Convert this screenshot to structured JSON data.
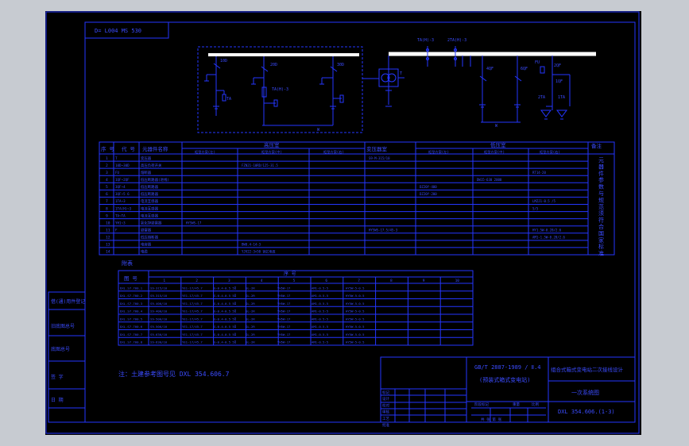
{
  "colors": {
    "line": "#2436ff",
    "text": "#3b4cff",
    "bus": "#ffffff",
    "background": "#000000",
    "window": "#c7cbd1"
  },
  "drawing_ref_tab": "D= L004 MS 530",
  "schematic": {
    "hv_labels": [
      "10D",
      "20D",
      "30D",
      "TA(H)-3",
      "TA"
    ],
    "hv_bottom": "W",
    "transformer_label": "T",
    "lv_top_labels": [
      "TA(H)-3",
      "2TA(H)-3"
    ],
    "lv_labels": [
      "4QF",
      "6QF",
      "FU",
      "2QF",
      "1QF",
      "2TA",
      "1TA"
    ],
    "lv_bottom": "W"
  },
  "main_table": {
    "headers": [
      "序 号",
      "代 号",
      "元器件名称",
      "高压室",
      "变压器室",
      "低压室",
      "备注"
    ],
    "hv_sub": [
      "柜型方案(左)",
      "柜型方案(中)",
      "柜型方案(右)"
    ],
    "lv_sub": [
      "柜型方案(左)",
      "柜型方案(中)",
      "柜型方案(右)"
    ],
    "rows": [
      {
        "no": "1",
        "code": "T",
        "name": "变压器",
        "cells": [
          "",
          "",
          "",
          "S9-M-315/10",
          "",
          "",
          ""
        ]
      },
      {
        "no": "2",
        "code": "10D~30D",
        "name": "高压负荷开关",
        "cells": [
          "",
          "FZN21-10RD/125-31.5",
          "",
          "",
          "",
          "",
          ""
        ]
      },
      {
        "no": "3",
        "code": "FU",
        "name": "熔断器",
        "cells": [
          "",
          "",
          "",
          "",
          "",
          "",
          "RT14-20"
        ]
      },
      {
        "no": "4",
        "code": "1QF~2QF",
        "name": "低压断路器(进线)",
        "cells": [
          "",
          "",
          "",
          "",
          "",
          "DW15-630 2000",
          ""
        ]
      },
      {
        "no": "5",
        "code": "3QF~4",
        "name": "低压断路器",
        "cells": [
          "",
          "",
          "",
          "",
          "DZ20Y-400",
          "",
          ""
        ]
      },
      {
        "no": "6",
        "code": "3QF~5 6",
        "name": "低压断路器",
        "cells": [
          "",
          "",
          "",
          "",
          "DZ20Y-200",
          "",
          ""
        ]
      },
      {
        "no": "7",
        "code": "1TA~3",
        "name": "电流互感器",
        "cells": [
          "",
          "",
          "",
          "",
          "",
          "",
          "LMZJ1-0.5 /5"
        ]
      },
      {
        "no": "8",
        "code": "1TA(H)~3",
        "name": "电流互感器",
        "cells": [
          "",
          "",
          "",
          "",
          "",
          "",
          "5/5"
        ]
      },
      {
        "no": "9",
        "code": "TA~TA",
        "name": "电流互感器",
        "cells": [
          "",
          "",
          "",
          "",
          "",
          "",
          ""
        ]
      },
      {
        "no": "10",
        "code": "YH1~3",
        "name": "氧化锌避雷器",
        "cells": [
          "HY5WS-17",
          "",
          "",
          "",
          "",
          "",
          ""
        ]
      },
      {
        "no": "11",
        "code": "F",
        "name": "避雷器",
        "cells": [
          "",
          "",
          "",
          "HY5WS-17.5/45-3",
          "",
          "",
          "HY1.5W-0.28/2.6"
        ]
      },
      {
        "no": "12",
        "code": "",
        "name": "低压熔断器",
        "cells": [
          "",
          "",
          "",
          "",
          "",
          "",
          "AM1-1.5W-0.28/2.6"
        ]
      },
      {
        "no": "13",
        "code": "",
        "name": "电容器",
        "cells": [
          "",
          "BW0.4-14-3",
          "",
          "",
          "",
          "",
          ""
        ]
      },
      {
        "no": "14",
        "code": "",
        "name": "电缆",
        "cells": [
          "",
          "YJV22-3×50 铜芯电缆",
          "",
          "",
          "",
          "",
          ""
        ]
      }
    ],
    "remark_vertical": "元器件参数与规范须符合国家标准"
  },
  "appendix": {
    "title": "附表",
    "col_header": "图 号",
    "group_header": "序 号",
    "col_numbers": [
      "1",
      "2",
      "3",
      "4",
      "5",
      "6",
      "7",
      "8",
      "9",
      "10"
    ],
    "rows": [
      [
        "DXL.S7.700.1",
        "S9-315/10",
        "YE1-17/45.7",
        "G-0.4-0.5 5Ω",
        "GL-2R",
        "YH5W-17",
        "AM1-0.5-5",
        "HY5W-5-0.5"
      ],
      [
        "DXL.S7.700.2",
        "S9-315/10",
        "YE1-17/45.7",
        "G-0.4-0.5 5Ω",
        "GL-2R",
        "YH5W-17",
        "AM1-0.5-5",
        "HY5W-5-0.5"
      ],
      [
        "DXL.S7.700.3",
        "S9-400/10",
        "YE1-17/45.7",
        "G-0.4-0.5 5Ω",
        "GL-2R",
        "YH5W-17",
        "AM1-0.5-5",
        "HY5W-5-0.5"
      ],
      [
        "DXL.S7.700.4",
        "S9-400/10",
        "YE1-17/45.7",
        "G-0.4-0.5 5Ω",
        "GL-2R",
        "YH5W-17",
        "AM1-0.5-5",
        "HY5W-5-0.5"
      ],
      [
        "DXL.S7.700.5",
        "S9-500/10",
        "YE1-17/45.7",
        "G-0.4-0.5 5Ω",
        "GL-2R",
        "YH5W-17",
        "AM1-0.5-5",
        "HY5W-5-0.5"
      ],
      [
        "DXL.S7.700.6",
        "S9-500/10",
        "YE1-17/45.7",
        "G-0.4-0.5 5Ω",
        "GL-2R",
        "YH5W-17",
        "AM1-0.5-5",
        "HY5W-5-0.5"
      ],
      [
        "DXL.S7.700.7",
        "S9-630/10",
        "YE1-17/45.7",
        "G-0.4-0.5 5Ω",
        "GL-2R",
        "YH5W-17",
        "AM1-0.5-5",
        "HY5W-5-0.5"
      ],
      [
        "DXL.S7.700.8",
        "S9-630/10",
        "YE1-17/45.7",
        "G-0.4-0.5 5Ω",
        "GL-2R",
        "YH5W-17",
        "AM1-0.5-5",
        "HY5W-5-0.5"
      ]
    ]
  },
  "note": "注：土建参考图号见 DXL 354.606.7",
  "left_stamp": [
    "借(通)用件登记",
    "旧底图总号",
    "底图总号",
    "签 字",
    "日 期"
  ],
  "title_block": {
    "standard": "GB/T 2887-1989 / Ⅱ.4",
    "spec": "(预装式箱式变电站)",
    "project": "组合式箱式变电站二次接线设计",
    "drawing_title": "一次系统图",
    "drawing_no": "DXL 354.606.(1-3)",
    "rows": [
      "标记",
      "设计",
      "校对",
      "审核",
      "工艺",
      "批准"
    ],
    "stage": "阶段标记",
    "weight": "重量",
    "scale": "比例",
    "sheet": "共 张 第 张"
  }
}
